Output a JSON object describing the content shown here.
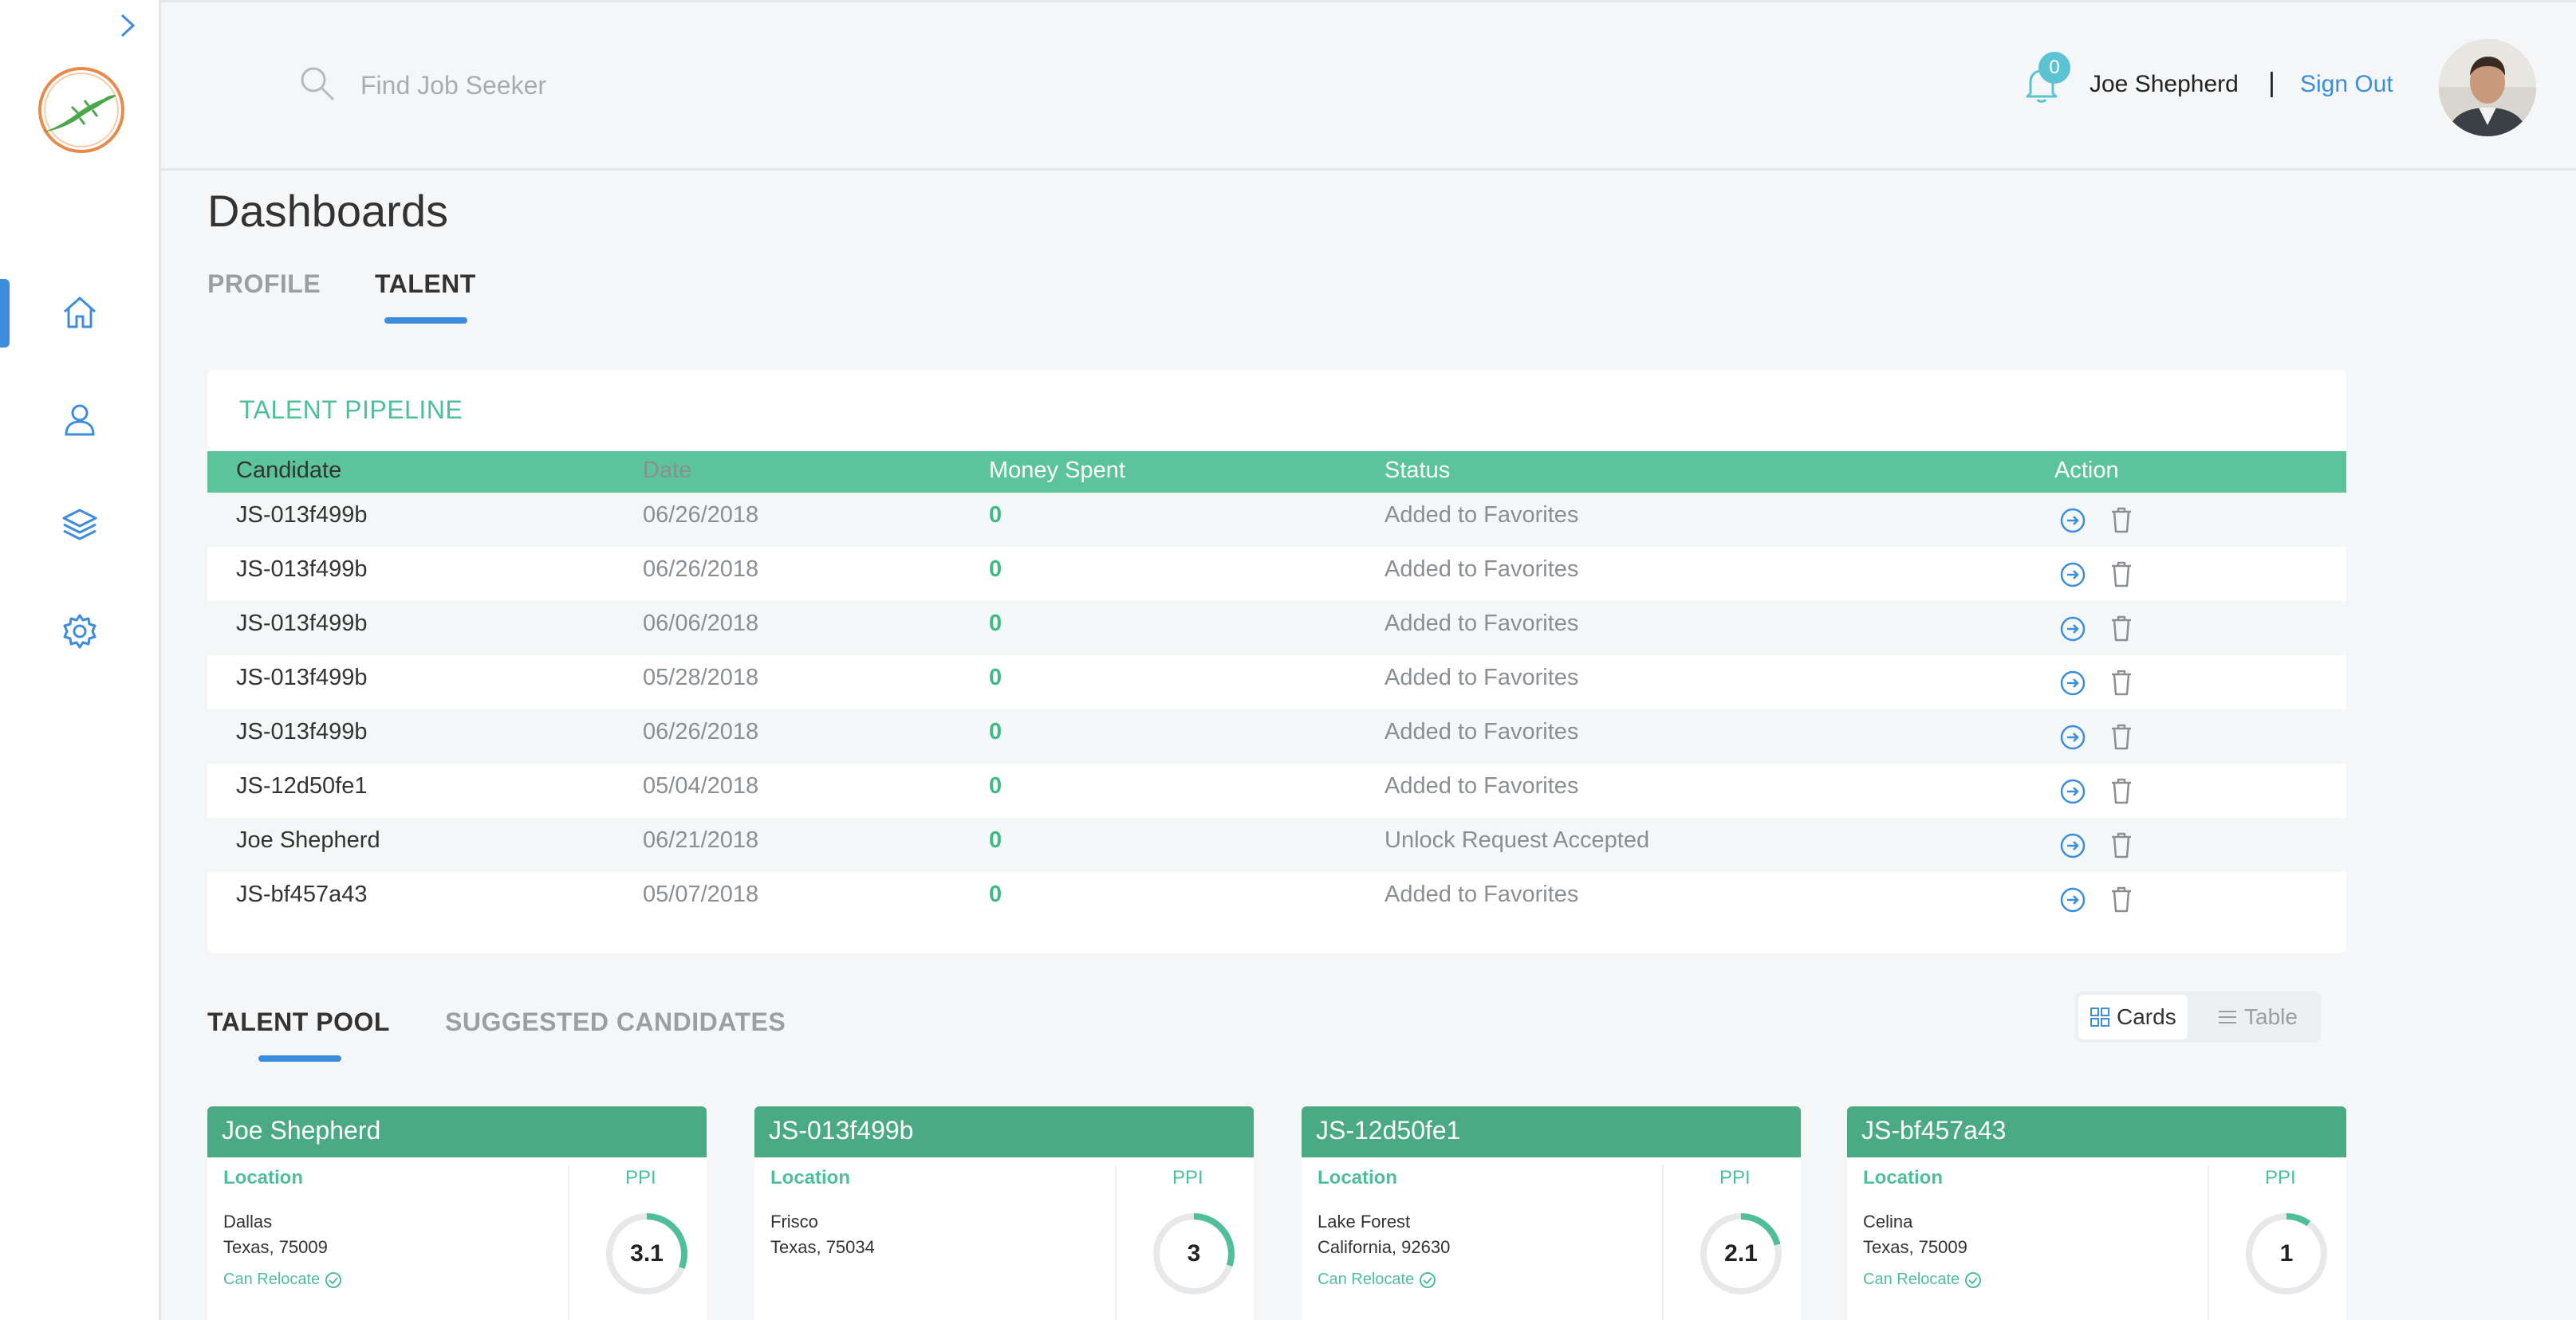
{
  "header": {
    "search_placeholder": "Find Job Seeker",
    "notifications_count": "0",
    "user_name": "Joe Shepherd",
    "separator": "|",
    "sign_out": "Sign Out"
  },
  "sidebar": {
    "items": [
      {
        "name": "home",
        "icon": "home-icon",
        "active": true
      },
      {
        "name": "profile",
        "icon": "user-icon",
        "active": false
      },
      {
        "name": "layers",
        "icon": "layers-icon",
        "active": false
      },
      {
        "name": "settings",
        "icon": "gear-icon",
        "active": false
      }
    ]
  },
  "page": {
    "title": "Dashboards",
    "tabs": [
      {
        "label": "PROFILE",
        "active": false
      },
      {
        "label": "TALENT",
        "active": true
      }
    ]
  },
  "pipeline": {
    "title": "TALENT PIPELINE",
    "columns": [
      "Candidate",
      "Date",
      "Money Spent",
      "Status",
      "Action"
    ],
    "rows": [
      {
        "candidate": "JS-013f499b",
        "date": "06/26/2018",
        "money": "0",
        "status": "Added to Favorites"
      },
      {
        "candidate": "JS-013f499b",
        "date": "06/26/2018",
        "money": "0",
        "status": "Added to Favorites"
      },
      {
        "candidate": "JS-013f499b",
        "date": "06/06/2018",
        "money": "0",
        "status": "Added to Favorites"
      },
      {
        "candidate": "JS-013f499b",
        "date": "05/28/2018",
        "money": "0",
        "status": "Added to Favorites"
      },
      {
        "candidate": "JS-013f499b",
        "date": "06/26/2018",
        "money": "0",
        "status": "Added to Favorites"
      },
      {
        "candidate": "JS-12d50fe1",
        "date": "05/04/2018",
        "money": "0",
        "status": "Added to Favorites"
      },
      {
        "candidate": "Joe Shepherd",
        "date": "06/21/2018",
        "money": "0",
        "status": "Unlock Request Accepted"
      },
      {
        "candidate": "JS-bf457a43",
        "date": "05/07/2018",
        "money": "0",
        "status": "Added to Favorites"
      }
    ]
  },
  "pool": {
    "tabs": [
      {
        "label": "TALENT POOL",
        "active": true
      },
      {
        "label": "SUGGESTED CANDIDATES",
        "active": false
      }
    ],
    "view_cards": "Cards",
    "view_table": "Table",
    "location_label": "Location",
    "ppi_label": "PPI",
    "relocate_label": "Can Relocate",
    "candidates": [
      {
        "name": "Joe Shepherd",
        "city": "Dallas",
        "state": "Texas, 75009",
        "relocate": true,
        "ppi": "3.1",
        "ppi_fraction": 0.31
      },
      {
        "name": "JS-013f499b",
        "city": "Frisco",
        "state": "Texas, 75034",
        "relocate": false,
        "ppi": "3",
        "ppi_fraction": 0.3
      },
      {
        "name": "JS-12d50fe1",
        "city": "Lake Forest",
        "state": "California, 92630",
        "relocate": true,
        "ppi": "2.1",
        "ppi_fraction": 0.21
      },
      {
        "name": "JS-bf457a43",
        "city": "Celina",
        "state": "Texas, 75009",
        "relocate": true,
        "ppi": "1",
        "ppi_fraction": 0.1
      }
    ]
  },
  "colors": {
    "accent_blue": "#3d8ddd",
    "brand_green": "#4fbf98",
    "table_header": "#5bc49c",
    "card_header": "#4aaa83"
  }
}
